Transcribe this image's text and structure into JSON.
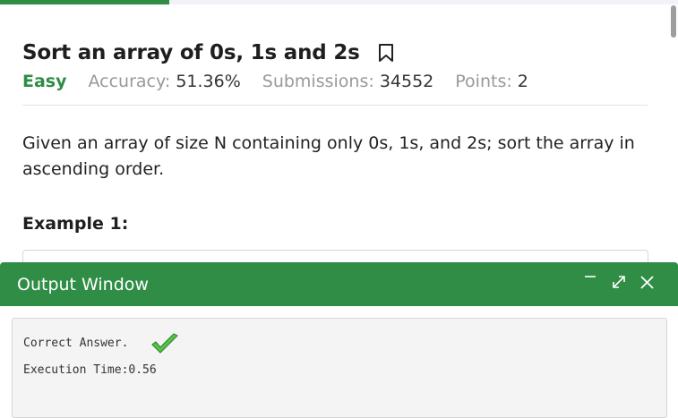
{
  "progress": {
    "fraction": 0.25
  },
  "problem": {
    "title": "Sort an array of 0s, 1s and 2s",
    "difficulty": "Easy",
    "accuracy_label": "Accuracy:",
    "accuracy_value": "51.36%",
    "submissions_label": "Submissions:",
    "submissions_value": "34552",
    "points_label": "Points:",
    "points_value": "2",
    "description": "Given an array of size N containing only 0s, 1s, and 2s; sort the array in ascending order.",
    "example_heading": "Example 1:"
  },
  "output_window": {
    "title": "Output Window",
    "line1": "Correct Answer.",
    "line2": "Execution Time:0.56"
  },
  "colors": {
    "accent": "#2f8d46",
    "muted": "#999999",
    "text": "#1e1e1e"
  },
  "icons": [
    "bookmark-icon",
    "minimize-icon",
    "expand-icon",
    "close-icon",
    "check-icon"
  ]
}
